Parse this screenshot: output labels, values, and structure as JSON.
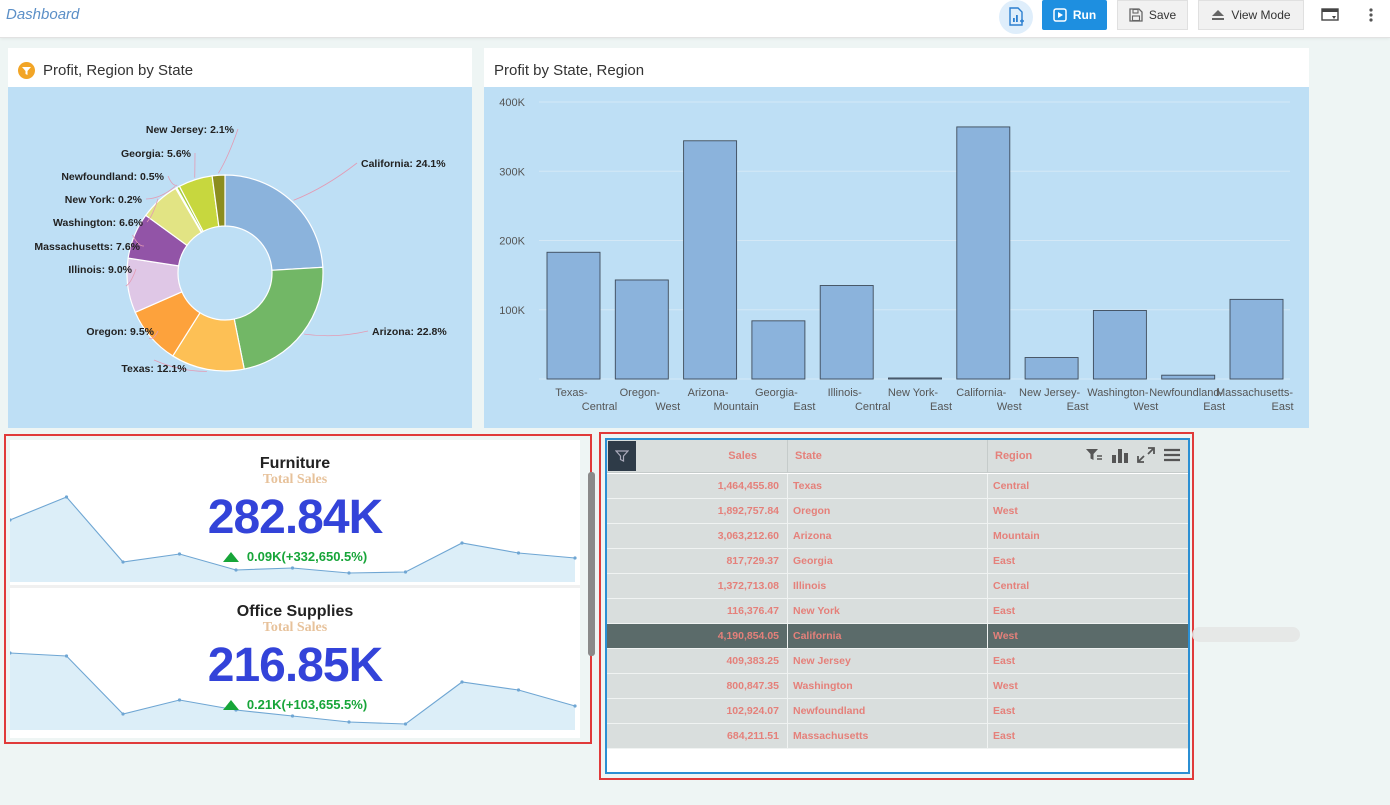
{
  "app": {
    "title": "Dashboard"
  },
  "toolbar": {
    "run_label": "Run",
    "save_label": "Save",
    "view_mode_label": "View Mode"
  },
  "colors": {
    "accent": "#1e8fe0",
    "plot_bg": "#bedff5",
    "bar": "#8bb3dc",
    "kpi_value": "#3343d9",
    "kpi_change": "#17a539",
    "table_text": "#e5807a",
    "selected_row": "#5b6b6a"
  },
  "pie_panel": {
    "title": "Profit, Region by State"
  },
  "bar_panel": {
    "title": "Profit by State, Region"
  },
  "chart_data": [
    {
      "type": "pie",
      "title": "Profit, Region by State",
      "donut": true,
      "slices": [
        {
          "label": "California",
          "pct": 24.1,
          "label_text": "California: 24.1%",
          "color": "#8bb3dc"
        },
        {
          "label": "Arizona",
          "pct": 22.8,
          "label_text": "Arizona: 22.8%",
          "color": "#72b766"
        },
        {
          "label": "Texas",
          "pct": 12.1,
          "label_text": "Texas: 12.1%",
          "color": "#fdc055"
        },
        {
          "label": "Oregon",
          "pct": 9.5,
          "label_text": "Oregon: 9.5%",
          "color": "#fda23c"
        },
        {
          "label": "Illinois",
          "pct": 9.0,
          "label_text": "Illinois: 9.0%",
          "color": "#dfc7e6"
        },
        {
          "label": "Massachusetts",
          "pct": 7.6,
          "label_text": "Massachusetts: 7.6%",
          "color": "#9254a7"
        },
        {
          "label": "Washington",
          "pct": 6.6,
          "label_text": "Washington: 6.6%",
          "color": "#e2e484"
        },
        {
          "label": "New York",
          "pct": 0.2,
          "label_text": "New York: 0.2%",
          "color": "#d0d0d0"
        },
        {
          "label": "Newfoundland",
          "pct": 0.5,
          "label_text": "Newfoundland: 0.5%",
          "color": "#a9cc3c"
        },
        {
          "label": "Georgia",
          "pct": 5.6,
          "label_text": "Georgia: 5.6%",
          "color": "#c7d73e"
        },
        {
          "label": "New Jersey",
          "pct": 2.1,
          "label_text": "New Jersey: 2.1%",
          "color": "#8c8d1f"
        }
      ]
    },
    {
      "type": "bar",
      "title": "Profit by State, Region",
      "categories": [
        [
          "Texas-",
          "Central"
        ],
        [
          "Oregon-",
          "West"
        ],
        [
          "Arizona-",
          "Mountain"
        ],
        [
          "Georgia-",
          "East"
        ],
        [
          "Illinois-",
          "Central"
        ],
        [
          "New York-",
          "East"
        ],
        [
          "California-",
          "West"
        ],
        [
          "New Jersey-",
          "East"
        ],
        [
          "Washington-",
          "West"
        ],
        [
          "Newfoundland-",
          "East"
        ],
        [
          "Massachusetts-",
          "East"
        ]
      ],
      "values": [
        183000,
        143000,
        344000,
        84000,
        135000,
        1500,
        364000,
        31000,
        99000,
        5500,
        115000
      ],
      "ylim": [
        0,
        400000
      ],
      "yticks": [
        100000,
        200000,
        300000,
        400000
      ],
      "ytick_labels": [
        "100K",
        "200K",
        "300K",
        "400K"
      ],
      "grid": true
    },
    {
      "type": "area",
      "name": "Furniture",
      "values": [
        62,
        85,
        20,
        28,
        12,
        14,
        9,
        10,
        39,
        29,
        24
      ]
    },
    {
      "type": "area",
      "name": "Office Supplies",
      "values": [
        77,
        74,
        16,
        30,
        20,
        14,
        8,
        6,
        48,
        40,
        24
      ]
    }
  ],
  "kpis": [
    {
      "name": "Furniture",
      "subtitle": "Total Sales",
      "value": "282.84K",
      "change": "0.09K(+332,650.5%)"
    },
    {
      "name": "Office Supplies",
      "subtitle": "Total Sales",
      "value": "216.85K",
      "change": "0.21K(+103,655.5%)"
    }
  ],
  "table": {
    "columns": [
      "Sales",
      "State",
      "Region"
    ],
    "rows": [
      {
        "sales": "1,464,455.80",
        "state": "Texas",
        "region": "Central"
      },
      {
        "sales": "1,892,757.84",
        "state": "Oregon",
        "region": "West"
      },
      {
        "sales": "3,063,212.60",
        "state": "Arizona",
        "region": "Mountain"
      },
      {
        "sales": "817,729.37",
        "state": "Georgia",
        "region": "East"
      },
      {
        "sales": "1,372,713.08",
        "state": "Illinois",
        "region": "Central"
      },
      {
        "sales": "116,376.47",
        "state": "New York",
        "region": "East"
      },
      {
        "sales": "4,190,854.05",
        "state": "California",
        "region": "West",
        "selected": true
      },
      {
        "sales": "409,383.25",
        "state": "New Jersey",
        "region": "East"
      },
      {
        "sales": "800,847.35",
        "state": "Washington",
        "region": "West"
      },
      {
        "sales": "102,924.07",
        "state": "Newfoundland",
        "region": "East"
      },
      {
        "sales": "684,211.51",
        "state": "Massachusetts",
        "region": "East"
      }
    ]
  }
}
